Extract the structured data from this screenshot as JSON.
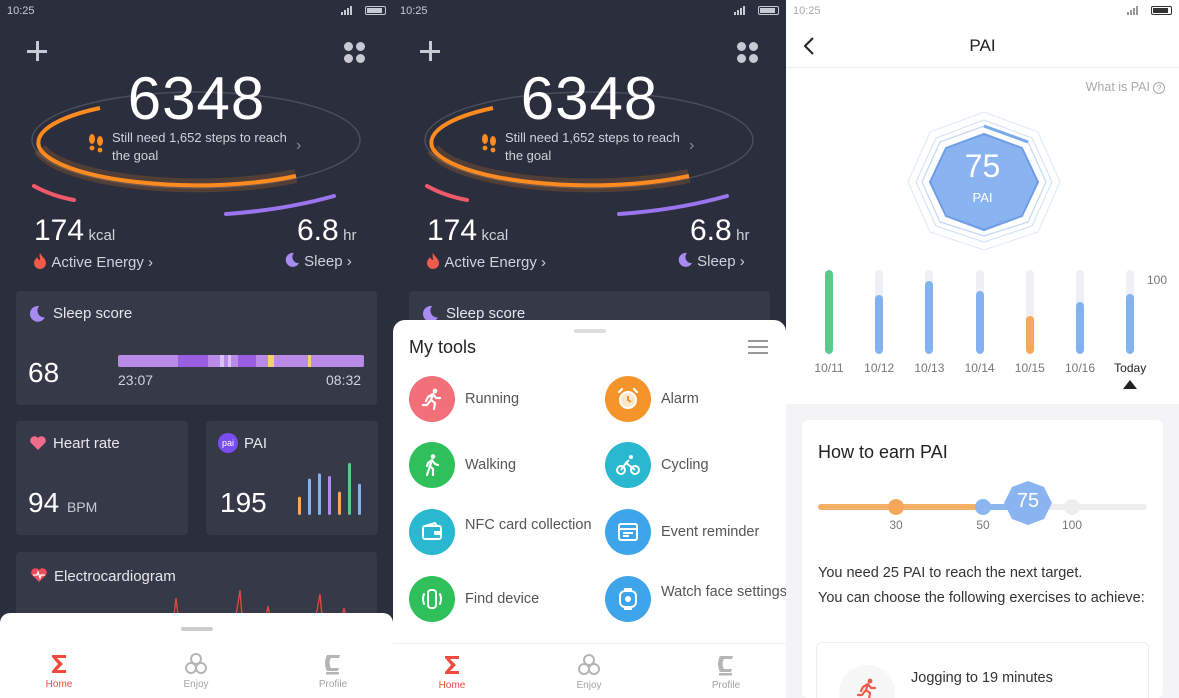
{
  "status": {
    "time": "10:25"
  },
  "home": {
    "steps": "6348",
    "steps_note": "Still need 1,652 steps to reach the goal",
    "kcal_value": "174",
    "kcal_unit": "kcal",
    "kcal_label": "Active Energy",
    "sleep_value": "6.8",
    "sleep_unit": "hr",
    "sleep_label": "Sleep",
    "sleep_card": {
      "title": "Sleep score",
      "score": "68",
      "start": "23:07",
      "end": "08:32"
    },
    "heart_card": {
      "title": "Heart rate",
      "value": "94",
      "unit": "BPM"
    },
    "pai_card": {
      "title": "PAI",
      "value": "195",
      "icon_text": "pai"
    },
    "ecg_card": {
      "title": "Electrocardiogram"
    },
    "pai_minibars": [
      0.35,
      0.7,
      0.8,
      0.75,
      0.45,
      1.0,
      0.6
    ]
  },
  "nav": {
    "items": [
      {
        "label": "Home"
      },
      {
        "label": "Enjoy"
      },
      {
        "label": "Profile"
      }
    ]
  },
  "tools": {
    "title": "My tools",
    "items": [
      {
        "label": "Running",
        "icon": "running-icon",
        "color": "#f2707a"
      },
      {
        "label": "Alarm",
        "icon": "alarm-icon",
        "color": "#f5942b"
      },
      {
        "label": "Walking",
        "icon": "walking-icon",
        "color": "#2fbf5b"
      },
      {
        "label": "Cycling",
        "icon": "cycling-icon",
        "color": "#29b8cf"
      },
      {
        "label": "NFC card collection",
        "icon": "wallet-icon",
        "color": "#29b8cf"
      },
      {
        "label": "Event reminder",
        "icon": "reminder-icon",
        "color": "#3fa5ea"
      },
      {
        "label": "Find device",
        "icon": "find-device-icon",
        "color": "#2fbf5b"
      },
      {
        "label": "Watch face settings",
        "icon": "watch-face-icon",
        "color": "#3fa5ea"
      }
    ]
  },
  "pai": {
    "title": "PAI",
    "what_is": "What is PAI",
    "score": "75",
    "score_label": "PAI",
    "max_label": "100",
    "history": [
      {
        "date": "10/11",
        "value": 100,
        "color": "#5cc98a"
      },
      {
        "date": "10/12",
        "value": 70,
        "color": "#82b3f0"
      },
      {
        "date": "10/13",
        "value": 87,
        "color": "#82b3f0"
      },
      {
        "date": "10/14",
        "value": 75,
        "color": "#82b3f0"
      },
      {
        "date": "10/15",
        "value": 45,
        "color": "#f5a85a"
      },
      {
        "date": "10/16",
        "value": 62,
        "color": "#82b3f0"
      },
      {
        "date": "Today",
        "value": 72,
        "color": "#82b3f0"
      }
    ],
    "earn": {
      "title": "How to earn PAI",
      "ticks": [
        "30",
        "50",
        "100"
      ],
      "current": "75",
      "text1": "You need 25 PAI to reach the next target.",
      "text2": "You can choose the following exercises to achieve:",
      "jog": "Jogging to 19 minutes"
    }
  }
}
